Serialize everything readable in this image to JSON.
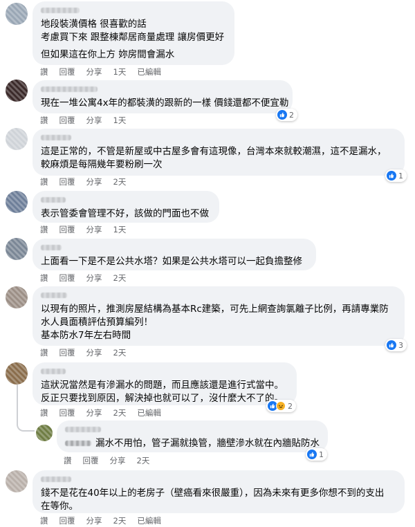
{
  "labels": {
    "like": "讚",
    "reply": "回覆",
    "share": "分享",
    "edited": "已編輯"
  },
  "comments": [
    {
      "lines": [
        "地段裝潢價格 很喜歡的話",
        "考慮買下來 跟整棟鄰居商量處理 讓房價更好",
        "但如果這在你上方 妳房間會漏水"
      ],
      "time": "1天",
      "edited": true,
      "reactions": null
    },
    {
      "lines": [
        "現在一堆公寓4x年的都裝潢的跟新的一樣 價錢還都不便宜勒"
      ],
      "time": "1天",
      "edited": false,
      "reactions": {
        "count": "2"
      }
    },
    {
      "lines": [
        "這是正常的，不管是新屋或中古屋多會有這現像，台灣本來就較潮濕，這不是漏水，",
        "較麻煩是每隔幾年要粉刷一次"
      ],
      "time": "2天",
      "edited": false,
      "reactions": {
        "count": "1"
      }
    },
    {
      "lines": [
        "表示管委會管理不好，該做的門面也不做"
      ],
      "time": "1天",
      "edited": false,
      "reactions": null
    },
    {
      "lines": [
        "上面看一下是不是公共水塔？如果是公共水塔可以一起負擔整修"
      ],
      "time": "2天",
      "edited": false,
      "reactions": null
    },
    {
      "lines": [
        "以現有的照片，推測房屋結構為基本Rc建築，可先上網查詢氯離子比例，再請專業防",
        "水人員面積評估預算編列！",
        "基本防水7年左右時間"
      ],
      "time": "2天",
      "edited": false,
      "reactions": {
        "count": "3"
      }
    },
    {
      "lines": [
        "這狀況當然是有滲漏水的問題，而且應該還是進行式當中。",
        "反正只要找到原因，解決掉也就可以了，沒什麼大不了的。"
      ],
      "time": "2天",
      "edited": true,
      "reactions": {
        "count": "2"
      }
    },
    {
      "lines": [
        "漏水不用怕，管子漏就換管，牆壁滲水就在內牆貼防水"
      ],
      "time": "2天",
      "edited": false,
      "reactions": {
        "count": "1"
      }
    },
    {
      "lines": [
        "錢不是花在40年以上的老房子（壁癌看來很嚴重），因為未來有更多你想不到的支出",
        "在等你。"
      ],
      "time": "2天",
      "edited": true,
      "reactions": null
    }
  ],
  "colors": {
    "bubble": "#f0f2f5",
    "meta_text": "#65676b",
    "like_blue": "#1877f2",
    "haha_yellow": "#f7b125"
  }
}
